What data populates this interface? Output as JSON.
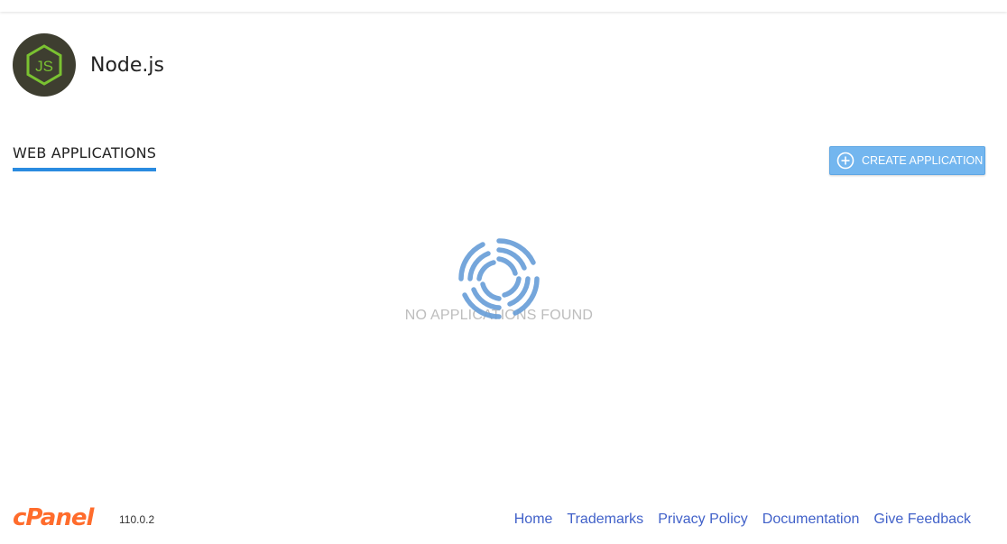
{
  "header": {
    "title": "Node.js",
    "logo_icon": "nodejs-hex-icon",
    "logo_text": "JS"
  },
  "tabs": [
    {
      "label": "WEB APPLICATIONS",
      "active": true
    }
  ],
  "actions": {
    "create_label": "CREATE APPLICATION",
    "create_icon": "plus-circle-icon"
  },
  "main": {
    "empty_message": "NO APPLICATIONS FOUND",
    "loading_icon": "spinner-icon"
  },
  "footer": {
    "brand": "cPanel",
    "version": "110.0.2",
    "links": [
      "Home",
      "Trademarks",
      "Privacy Policy",
      "Documentation",
      "Give Feedback"
    ]
  },
  "colors": {
    "accent": "#2a8be0",
    "button": "#73b6ef",
    "brand": "#ff6c2c",
    "link": "#4161c9",
    "logo_bg": "#3e3e30",
    "logo_green": "#7ac231"
  }
}
